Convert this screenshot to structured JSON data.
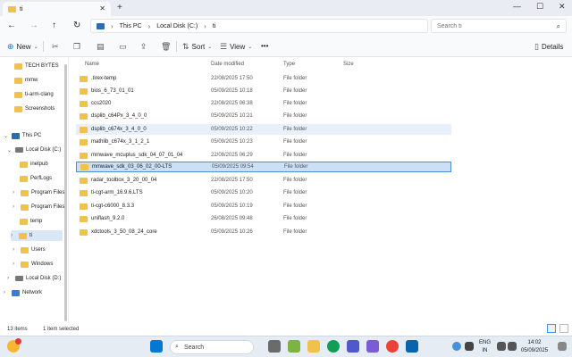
{
  "window": {
    "tab_title": "ti",
    "new_tab_glyph": "+",
    "minimize_glyph": "—",
    "maximize_glyph": "☐",
    "close_glyph": "✕"
  },
  "nav": {
    "back_glyph": "←",
    "forward_glyph": "→",
    "up_glyph": "↑",
    "refresh_glyph": "↻",
    "breadcrumbs": [
      "This PC",
      "Local Disk (C:)",
      "ti"
    ],
    "search_placeholder": "Search ti"
  },
  "toolbar": {
    "new_label": "New",
    "sort_label": "Sort",
    "view_label": "View",
    "more_label": "•••",
    "details_label": "Details"
  },
  "sidebar": {
    "quick": [
      "TECH BYTES",
      "mmw",
      "ti-arm-clang",
      "Screenshots"
    ],
    "this_pc": "This PC",
    "local_disk_c": "Local Disk (C:)",
    "c_children": [
      "inetpub",
      "PerfLogs",
      "Program Files",
      "Program Files",
      "temp",
      "ti",
      "Users",
      "Windows"
    ],
    "local_disk_d": "Local Disk (D:)",
    "network": "Network"
  },
  "columns": {
    "name": "Name",
    "date": "Date modified",
    "type": "Type",
    "size": "Size"
  },
  "files": [
    {
      "name": ".tirex-temp",
      "date": "22/08/2025 17:50",
      "type": "File folder"
    },
    {
      "name": "bios_6_73_01_01",
      "date": "05/09/2025 10:18",
      "type": "File folder"
    },
    {
      "name": "ccs2020",
      "date": "22/08/2025 06:38",
      "type": "File folder"
    },
    {
      "name": "dsplib_c64Px_3_4_0_0",
      "date": "05/09/2025 10:21",
      "type": "File folder"
    },
    {
      "name": "dsplib_c674x_3_4_0_0",
      "date": "05/09/2025 10:22",
      "type": "File folder"
    },
    {
      "name": "mathlib_c674x_3_1_2_1",
      "date": "05/09/2025 10:23",
      "type": "File folder"
    },
    {
      "name": "mmwave_mcuplus_sdk_04_07_01_04",
      "date": "22/08/2025 06:29",
      "type": "File folder"
    },
    {
      "name": "mmwave_sdk_03_06_02_00-LTS",
      "date": "05/09/2025 09:54",
      "type": "File folder"
    },
    {
      "name": "radar_toolbox_3_20_00_04",
      "date": "22/08/2025 17:50",
      "type": "File folder"
    },
    {
      "name": "ti-cgt-arm_16.9.6.LTS",
      "date": "05/09/2025 10:20",
      "type": "File folder"
    },
    {
      "name": "ti-cgt-c6000_8.3.3",
      "date": "05/09/2025 10:19",
      "type": "File folder"
    },
    {
      "name": "uniflash_9.2.0",
      "date": "26/08/2025 09:48",
      "type": "File folder"
    },
    {
      "name": "xdctools_3_50_08_24_core",
      "date": "05/09/2025 10:26",
      "type": "File folder"
    }
  ],
  "status": {
    "items": "13 items",
    "selected": "1 item selected"
  },
  "taskbar": {
    "search_label": "Search",
    "lang_top": "ENG",
    "lang_bottom": "IN",
    "time": "14:02",
    "date": "05/09/2025"
  }
}
